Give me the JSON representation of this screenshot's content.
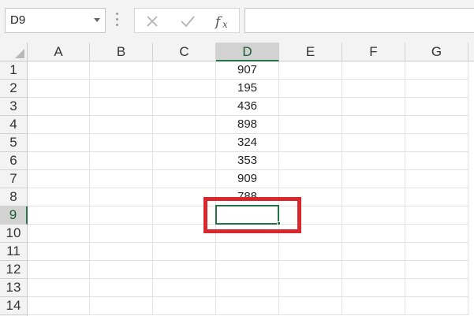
{
  "formula_bar": {
    "name_box": "D9",
    "cancel_icon": "close-icon",
    "enter_icon": "check-icon",
    "function_icon": "fx",
    "formula_value": ""
  },
  "grid": {
    "columns": [
      "A",
      "B",
      "C",
      "D",
      "E",
      "F",
      "G"
    ],
    "selected_column": "D",
    "rows": [
      "1",
      "2",
      "3",
      "4",
      "5",
      "6",
      "7",
      "8",
      "9",
      "10",
      "11",
      "12",
      "13",
      "14"
    ],
    "selected_row": "9",
    "column_d_values": [
      "907",
      "195",
      "436",
      "898",
      "324",
      "353",
      "909",
      "788"
    ],
    "active_cell": "D9"
  },
  "colors": {
    "accent": "#217346",
    "highlight": "#d9272e",
    "header_bg": "#f3f3f3",
    "selected_header_bg": "#d2d2d2"
  }
}
